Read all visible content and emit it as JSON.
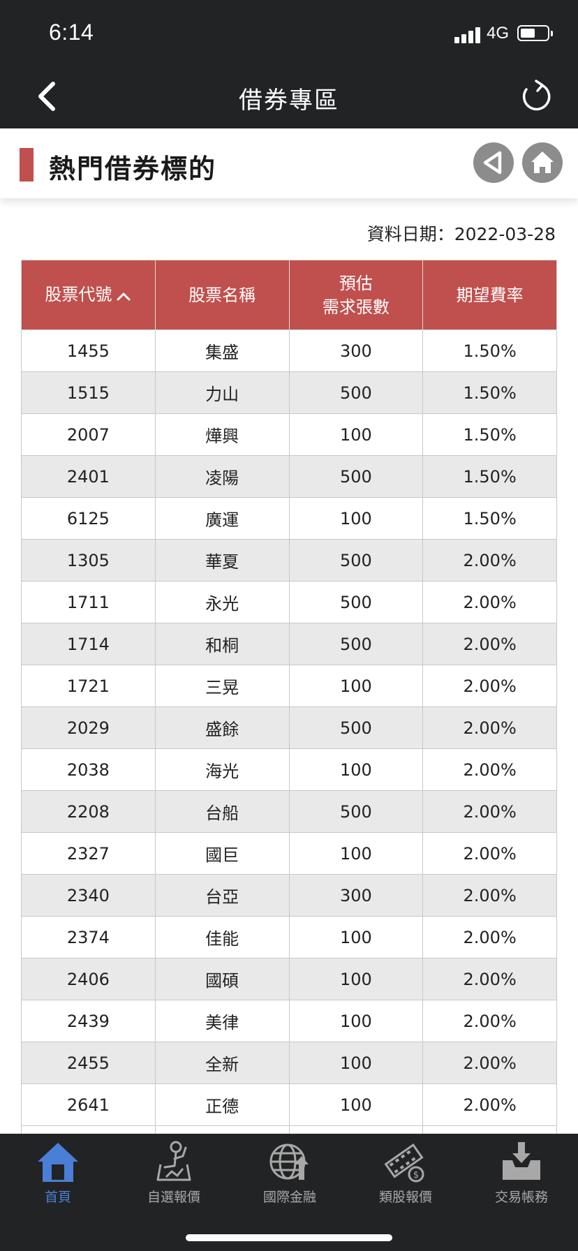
{
  "status": {
    "time": "6:14",
    "network": "4G"
  },
  "nav": {
    "title": "借券專區"
  },
  "section": {
    "title": "熱門借券標的"
  },
  "data_date": "資料日期：2022-03-28",
  "table": {
    "headers": [
      "股票代號",
      "股票名稱",
      "預估",
      "需求張數",
      "期望費率"
    ],
    "rows": [
      [
        "1455",
        "集盛",
        "300",
        "1.50%"
      ],
      [
        "1515",
        "力山",
        "500",
        "1.50%"
      ],
      [
        "2007",
        "燁興",
        "100",
        "1.50%"
      ],
      [
        "2401",
        "凌陽",
        "500",
        "1.50%"
      ],
      [
        "6125",
        "廣運",
        "100",
        "1.50%"
      ],
      [
        "1305",
        "華夏",
        "500",
        "2.00%"
      ],
      [
        "1711",
        "永光",
        "500",
        "2.00%"
      ],
      [
        "1714",
        "和桐",
        "500",
        "2.00%"
      ],
      [
        "1721",
        "三晃",
        "100",
        "2.00%"
      ],
      [
        "2029",
        "盛餘",
        "500",
        "2.00%"
      ],
      [
        "2038",
        "海光",
        "100",
        "2.00%"
      ],
      [
        "2208",
        "台船",
        "500",
        "2.00%"
      ],
      [
        "2327",
        "國巨",
        "100",
        "2.00%"
      ],
      [
        "2340",
        "台亞",
        "300",
        "2.00%"
      ],
      [
        "2374",
        "佳能",
        "100",
        "2.00%"
      ],
      [
        "2406",
        "國碩",
        "100",
        "2.00%"
      ],
      [
        "2439",
        "美律",
        "100",
        "2.00%"
      ],
      [
        "2455",
        "全新",
        "100",
        "2.00%"
      ],
      [
        "2641",
        "正德",
        "100",
        "2.00%"
      ]
    ]
  },
  "tabs": [
    {
      "label": "首頁",
      "icon": "home-icon",
      "active": true
    },
    {
      "label": "自選報價",
      "icon": "person-chart-icon"
    },
    {
      "label": "國際金融",
      "icon": "globe-icon"
    },
    {
      "label": "類股報價",
      "icon": "film-coin-icon"
    },
    {
      "label": "交易帳務",
      "icon": "inbox-download-icon"
    }
  ],
  "colors": {
    "header_red": "#c0504d",
    "dark_bar": "#222325",
    "active_tab": "#4a7fd8",
    "inactive_tab": "#a8a8a8",
    "row_alt": "#e9e9e9"
  }
}
